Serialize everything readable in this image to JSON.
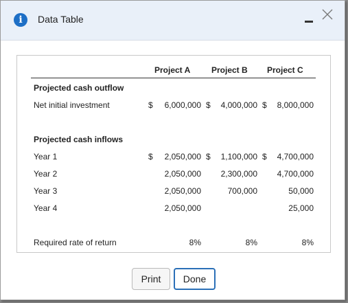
{
  "window": {
    "title": "Data Table"
  },
  "table": {
    "columns": [
      "Project A",
      "Project B",
      "Project C"
    ],
    "sections": {
      "outflow_heading": "Projected cash outflow",
      "inflows_heading": "Projected cash inflows"
    },
    "rows": {
      "net": {
        "label": "Net initial investment",
        "cur": "$",
        "values": [
          "6,000,000",
          "4,000,000",
          "8,000,000"
        ]
      },
      "y1": {
        "label": "Year 1",
        "cur": "$",
        "values": [
          "2,050,000",
          "1,100,000",
          "4,700,000"
        ]
      },
      "y2": {
        "label": "Year 2",
        "values": [
          "2,050,000",
          "2,300,000",
          "4,700,000"
        ]
      },
      "y3": {
        "label": "Year 3",
        "values": [
          "2,050,000",
          "700,000",
          "50,000"
        ]
      },
      "y4": {
        "label": "Year 4",
        "values": [
          "2,050,000",
          "",
          "25,000"
        ]
      },
      "rate": {
        "label": "Required rate of return",
        "values": [
          "8%",
          "8%",
          "8%"
        ]
      }
    }
  },
  "buttons": {
    "print": "Print",
    "done": "Done"
  },
  "colors": {
    "titlebar_bg": "#e9f0f9",
    "info_icon": "#1d6fc6",
    "done_border": "#2a6fb7"
  }
}
